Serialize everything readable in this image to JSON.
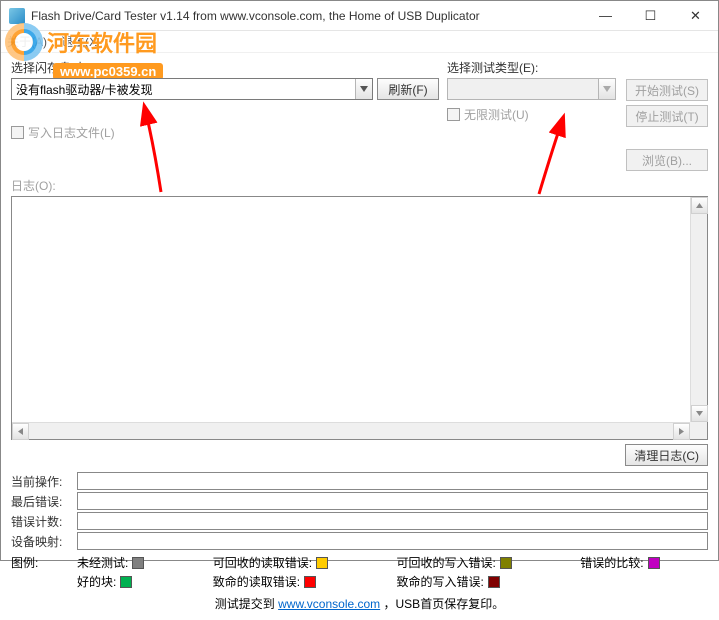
{
  "window": {
    "title": "Flash Drive/Card Tester v1.14 from www.vconsole.com, the Home of USB Duplicator",
    "min": "—",
    "max": "☐",
    "close": "✕"
  },
  "menu": {
    "about": "关于(A)",
    "exit": "退出(X)"
  },
  "watermark": {
    "line1": "河东软件园",
    "line2": "www.pc0359.cn"
  },
  "left": {
    "select_drive_label": "选择闪存盘/卡(D):",
    "drive_value": "没有flash驱动器/卡被发现",
    "refresh_btn": "刷新(F)"
  },
  "right": {
    "select_test_label": "选择测试类型(E):",
    "test_value": "",
    "unlimited_chk": "无限测试(U)",
    "start_btn": "开始测试(S)",
    "stop_btn": "停止测试(T)"
  },
  "logopts": {
    "write_log_chk": "写入日志文件(L)",
    "browse_btn": "浏览(B)..."
  },
  "log": {
    "label": "日志(O):",
    "clear_btn": "清理日志(C)"
  },
  "status": {
    "current_op": "当前操作:",
    "last_error": "最后错误:",
    "error_count": "错误计数:",
    "device_map": "设备映射:"
  },
  "legend": {
    "label": "图例:",
    "untested": "未经测试:",
    "good": "好的块:",
    "recov_read": "可回收的读取错误:",
    "fatal_read": "致命的读取错误:",
    "recov_write": "可回收的写入错误:",
    "fatal_write": "致命的写入错误:",
    "compare_err": "错误的比较:",
    "colors": {
      "untested": "#808080",
      "good": "#00b050",
      "recov_read": "#ffcc00",
      "fatal_read": "#ff0000",
      "recov_write": "#808000",
      "fatal_write": "#800000",
      "compare_err": "#c000c0"
    }
  },
  "footer": {
    "prefix": "测试提交到  ",
    "link_text": "www.vconsole.com",
    "suffix": "，USB首页保存复印。"
  }
}
